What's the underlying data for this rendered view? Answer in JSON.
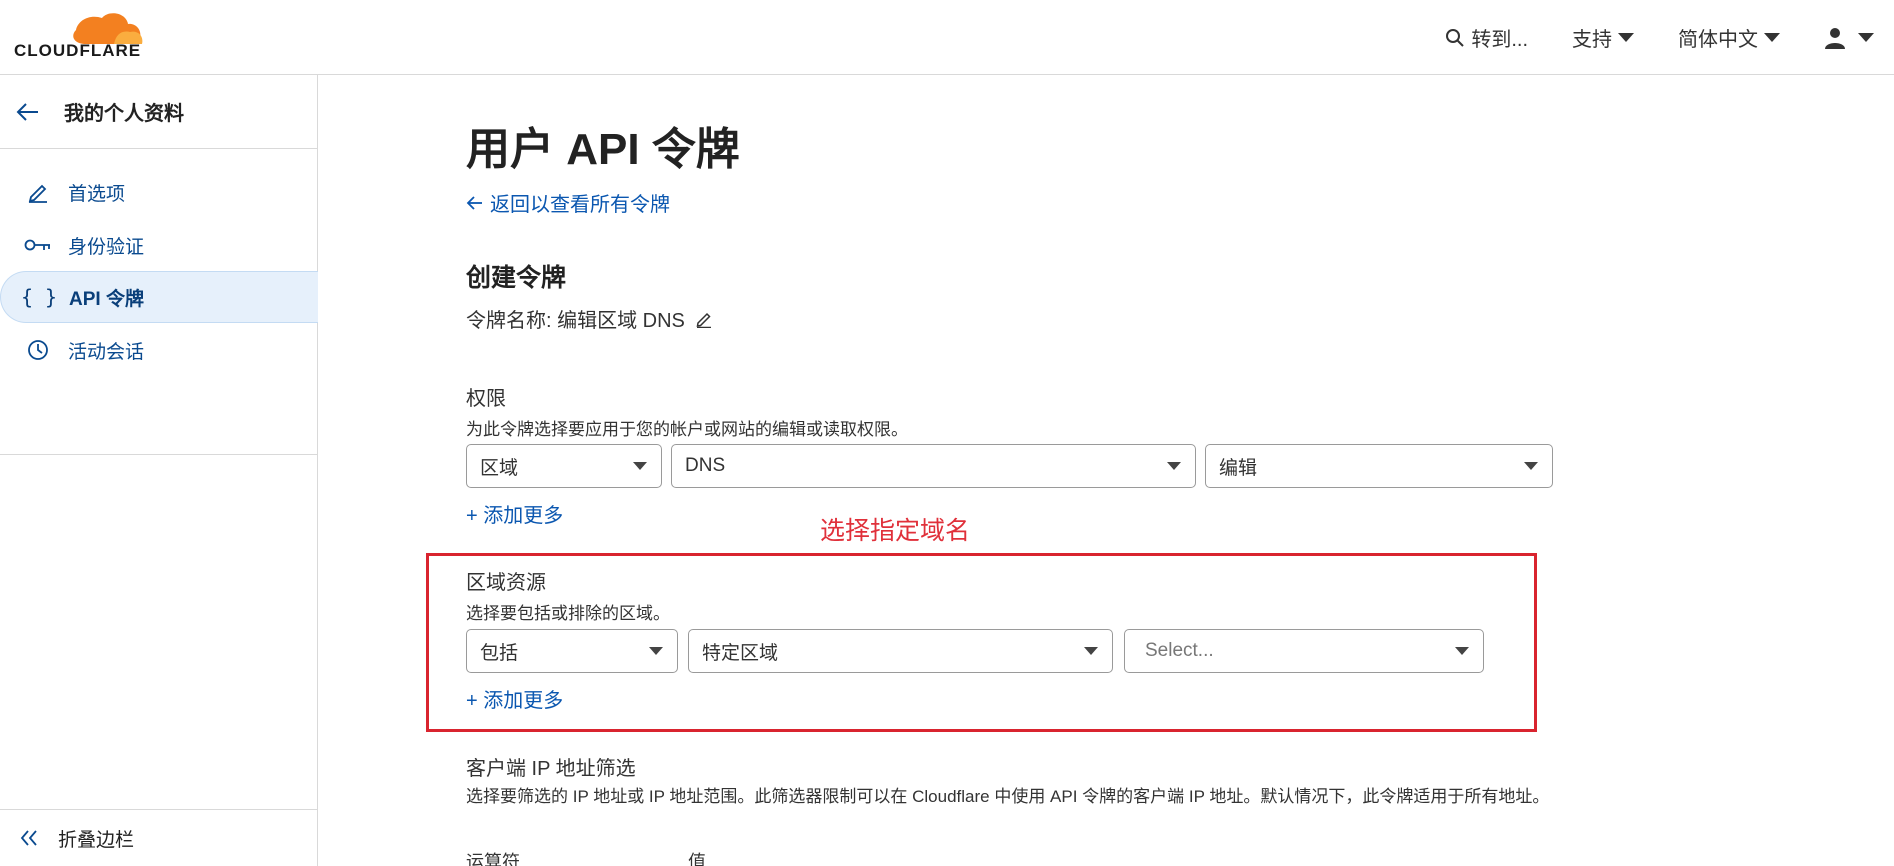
{
  "header": {
    "logo_text": "CLOUDFLARE",
    "goto_label": "转到...",
    "support_label": "支持",
    "language_label": "简体中文"
  },
  "sidebar": {
    "back_title": "我的个人资料",
    "items": [
      {
        "label": "首选项",
        "icon": "pencil-icon"
      },
      {
        "label": "身份验证",
        "icon": "key-icon"
      },
      {
        "label": "API 令牌",
        "icon": "braces-icon",
        "active": true
      },
      {
        "label": "活动会话",
        "icon": "clock-icon"
      }
    ],
    "collapse_label": "折叠边栏"
  },
  "main": {
    "page_title": "用户 API 令牌",
    "back_link": "返回以查看所有令牌",
    "section_title": "创建令牌",
    "token_name": "令牌名称: 编辑区域 DNS",
    "permissions": {
      "label": "权限",
      "description": "为此令牌选择要应用于您的帐户或网站的编辑或读取权限。",
      "selects": [
        "区域",
        "DNS",
        "编辑"
      ],
      "add_more": "+ 添加更多"
    },
    "annotation": "选择指定域名",
    "zone_resources": {
      "label": "区域资源",
      "description": "选择要包括或排除的区域。",
      "selects": [
        "包括",
        "特定区域"
      ],
      "select_placeholder": "Select...",
      "add_more": "+ 添加更多"
    },
    "client_ip": {
      "label": "客户端 IP 地址筛选",
      "description": "选择要筛选的 IP 地址或 IP 地址范围。此筛选器限制可以在 Cloudflare 中使用 API 令牌的客户端 IP 地址。默认情况下，此令牌适用于所有地址。",
      "col_operator": "运算符",
      "col_value": "值"
    }
  },
  "colors": {
    "link_blue": "#0b57b0",
    "annotation_red": "#d9242f",
    "active_bg": "#e6f0fb",
    "logo_orange": "#f38020"
  }
}
